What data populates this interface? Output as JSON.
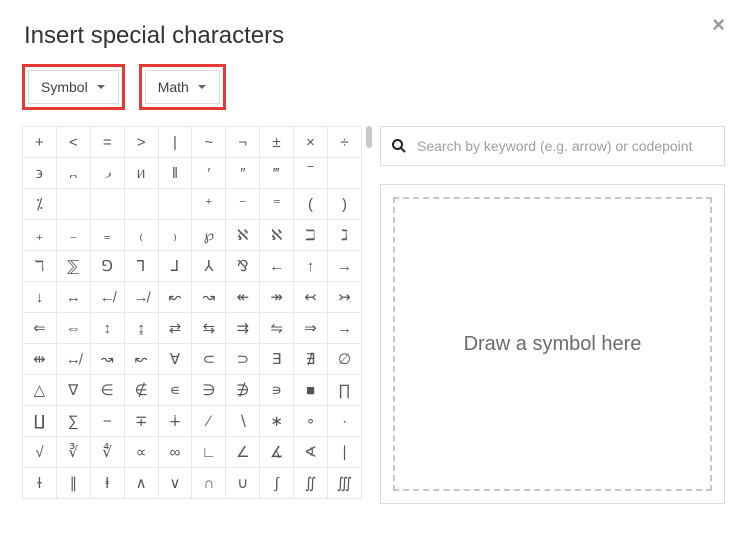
{
  "close_glyph": "×",
  "title": "Insert special characters",
  "dropdowns": {
    "category_label": "Symbol",
    "subcategory_label": "Math"
  },
  "search": {
    "placeholder": "Search by keyword (e.g. arrow) or codepoint"
  },
  "draw_placeholder": "Draw a symbol here",
  "char_rows": [
    [
      "+",
      "<",
      "=",
      ">",
      "|",
      "~",
      "¬",
      "±",
      "×",
      "÷"
    ],
    [
      "϶",
      "᎔",
      "᎕",
      "ᥢ",
      "‖",
      "′",
      "″",
      "‴",
      "‾",
      ""
    ],
    [
      "⁒",
      "",
      "",
      "",
      "",
      "⁺",
      "⁻",
      "⁼",
      "(",
      ")"
    ],
    [
      "₊",
      "₋",
      "₌",
      "₍",
      "₎",
      "℘",
      "ℵ",
      "ℵ",
      "ℶ",
      "ℷ"
    ],
    [
      "ℸ",
      "⅀",
      "⅁",
      "⅂",
      "⅃",
      "⅄",
      "⅋",
      "←",
      "↑",
      "→"
    ],
    [
      "↓",
      "↔",
      "↚",
      "↛",
      "↜",
      "↝",
      "↞",
      "↠",
      "↢",
      "↣"
    ],
    [
      "⇐",
      "⇔",
      "↕",
      "↨",
      "⇄",
      "⇆",
      "⇉",
      "⇋",
      "⇒",
      "→"
    ],
    [
      "⇹",
      "↮",
      "↝",
      "↜",
      "∀",
      "⊂",
      "⊃",
      "∃",
      "∄",
      "∅"
    ],
    [
      "△",
      "∇",
      "∈",
      "∉",
      "∊",
      "∋",
      "∌",
      "∍",
      "■",
      "∏"
    ],
    [
      "∐",
      "∑",
      "−",
      "∓",
      "∔",
      "∕",
      "∖",
      "∗",
      "∘",
      "∙"
    ],
    [
      "√",
      "∛",
      "∜",
      "∝",
      "∞",
      "∟",
      "∠",
      "∡",
      "∢",
      "∣"
    ],
    [
      "ɫ",
      "∥",
      "ⱡ",
      "∧",
      "∨",
      "∩",
      "∪",
      "∫",
      "∬",
      "∭"
    ]
  ]
}
